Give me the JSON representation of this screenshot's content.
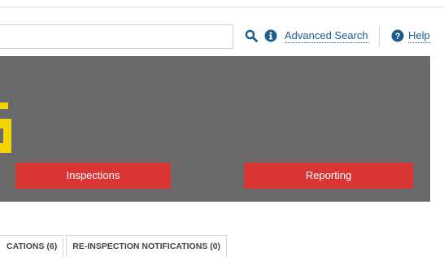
{
  "search": {
    "placeholder": "",
    "value": ""
  },
  "header": {
    "advanced_search_label": "Advanced Search",
    "help_label": "Help"
  },
  "hero": {
    "inspections_label": "Inspections",
    "reporting_label": "Reporting",
    "background_color": "#6a6a6a",
    "button_color": "#d93535",
    "logo_color": "#f2d400"
  },
  "tabs": [
    {
      "label": "CATIONS (6)"
    },
    {
      "label": "RE-INSPECTION NOTIFICATIONS (0)"
    }
  ],
  "icons": {
    "search": "search-icon",
    "info": "info-icon",
    "help": "help-icon"
  }
}
